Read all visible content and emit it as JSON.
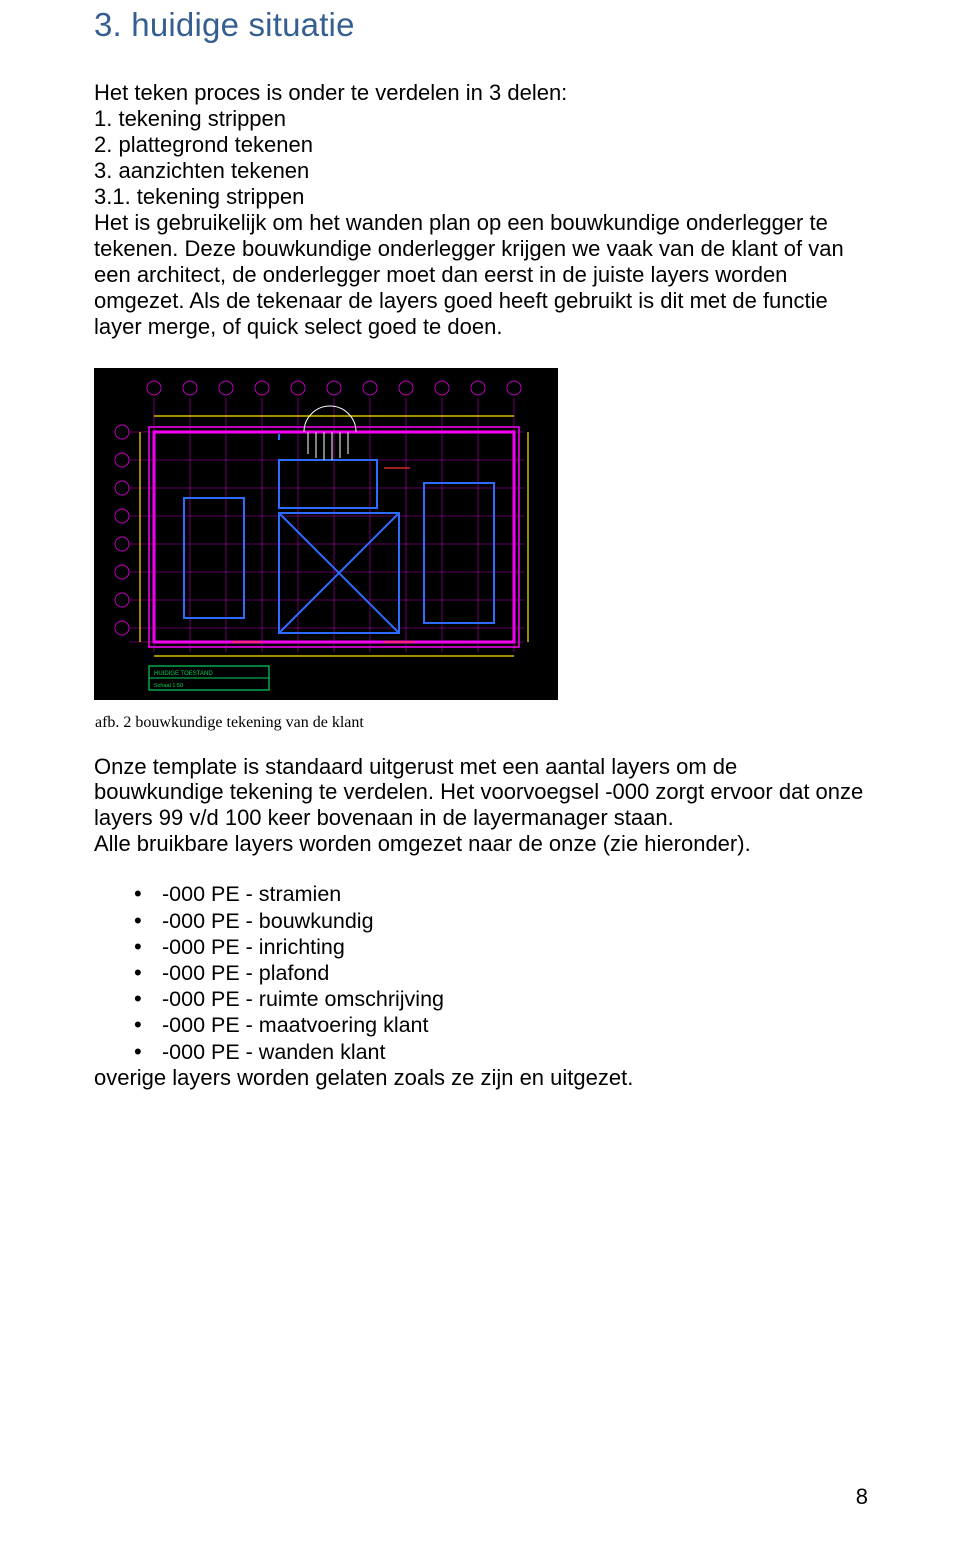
{
  "section": {
    "title": "3. huidige situatie"
  },
  "intro": "Het teken proces is onder te verdelen in 3 delen:",
  "steps": {
    "s1": "1. tekening strippen",
    "s2": "2. plattegrond tekenen",
    "s3": "3. aanzichten tekenen"
  },
  "subsection": {
    "heading": "3.1. tekening strippen",
    "p1": "Het is gebruikelijk om het wanden plan op een bouwkundige onderlegger te tekenen. Deze bouwkundige onderlegger krijgen we vaak van de klant of van een architect, de onderlegger moet dan eerst in de juiste layers worden omgezet. Als de tekenaar de layers goed heeft gebruikt is dit met de functie layer merge, of quick select goed te doen."
  },
  "figure": {
    "caption": "afb. 2 bouwkundige tekening van de klant"
  },
  "p2": "Onze template is standaard uitgerust met een aantal layers om de bouwkundige tekening te verdelen. Het voorvoegsel -000 zorgt ervoor dat onze layers 99 v/d 100 keer bovenaan in de layermanager staan.",
  "p2b": "Alle bruikbare layers worden omgezet naar de onze (zie hieronder).",
  "layers": {
    "l1": "-000 PE - stramien",
    "l2": "-000 PE - bouwkundig",
    "l3": "-000 PE - inrichting",
    "l4": "-000 PE - plafond",
    "l5": "-000 PE - ruimte omschrijving",
    "l6": "-000 PE - maatvoering klant",
    "l7": "-000 PE - wanden klant"
  },
  "closing": "overige layers worden gelaten zoals ze zijn en uitgezet.",
  "page_number": "8"
}
